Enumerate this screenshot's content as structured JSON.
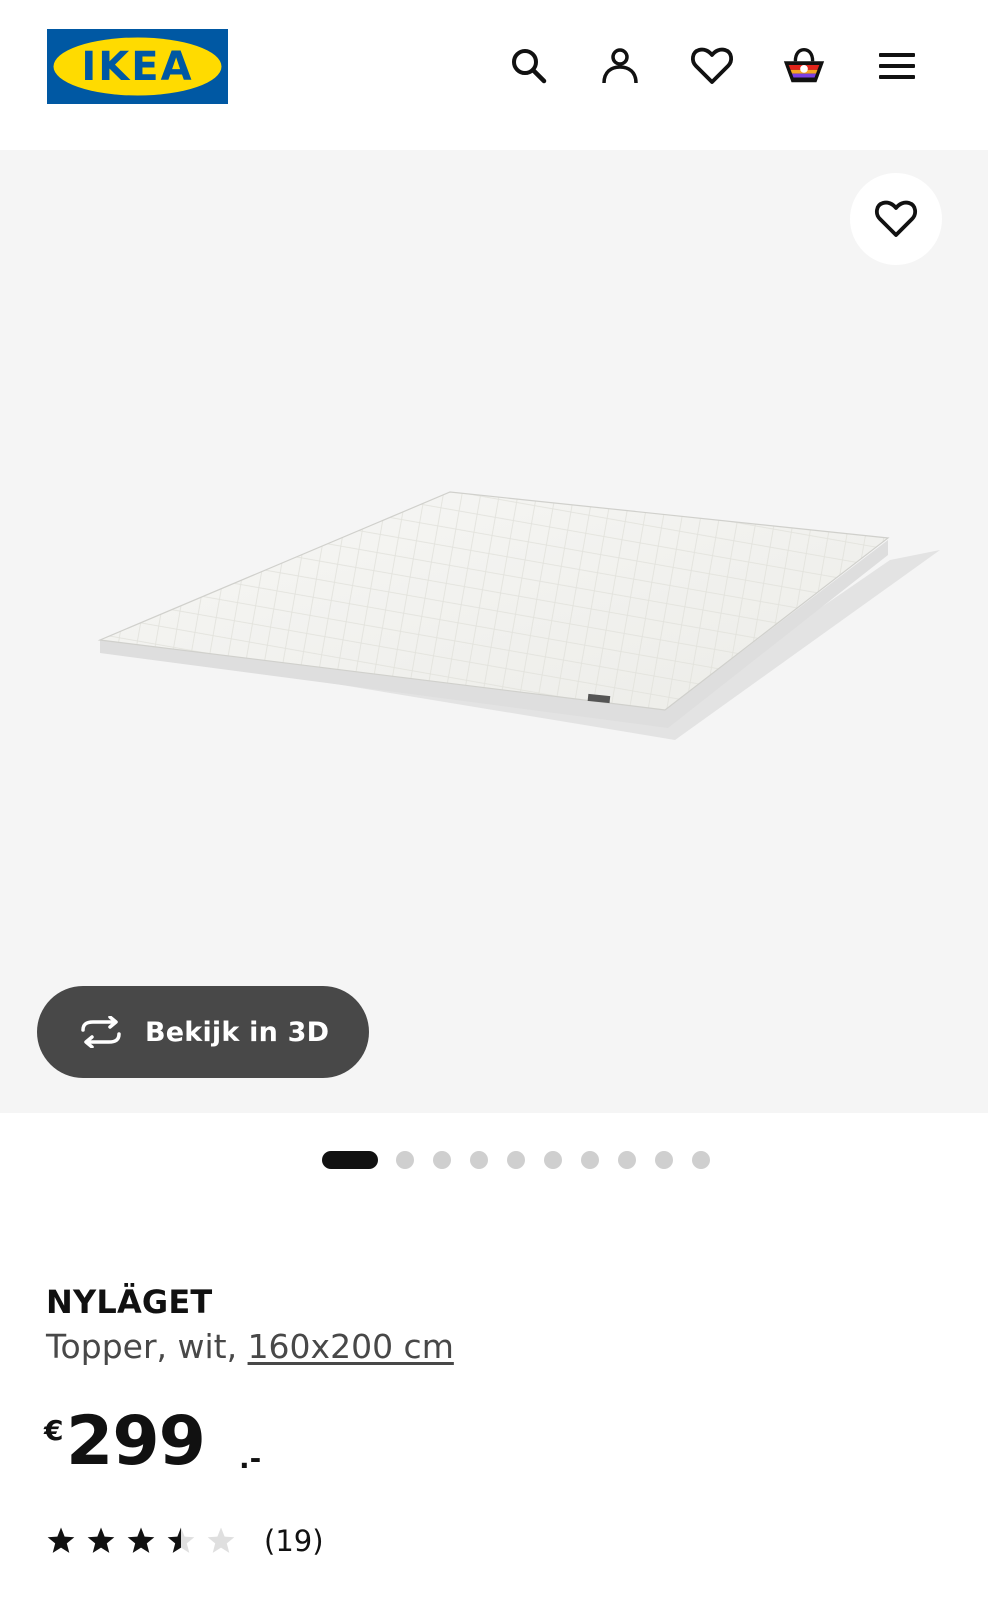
{
  "brand": {
    "logo_text": "IKEA",
    "colors": {
      "blue": "#0058a3",
      "yellow": "#ffdb00"
    }
  },
  "header": {
    "icons": [
      "search-icon",
      "account-icon",
      "favourites-heart-icon",
      "shopping-bag-icon",
      "menu-hamburger-icon"
    ]
  },
  "gallery": {
    "view_3d_label": "Bekijk in 3D",
    "image_count": 10,
    "active_index": 0,
    "favourite_icon": "heart-icon"
  },
  "product": {
    "name": "NYLÄGET",
    "description_prefix": "Topper, wit, ",
    "size_link": "160x200 cm",
    "price": {
      "currency": "€",
      "integer": "299",
      "decimals": ".-"
    },
    "rating": {
      "value": 3.5,
      "max": 5,
      "count_label": "(19)"
    }
  }
}
